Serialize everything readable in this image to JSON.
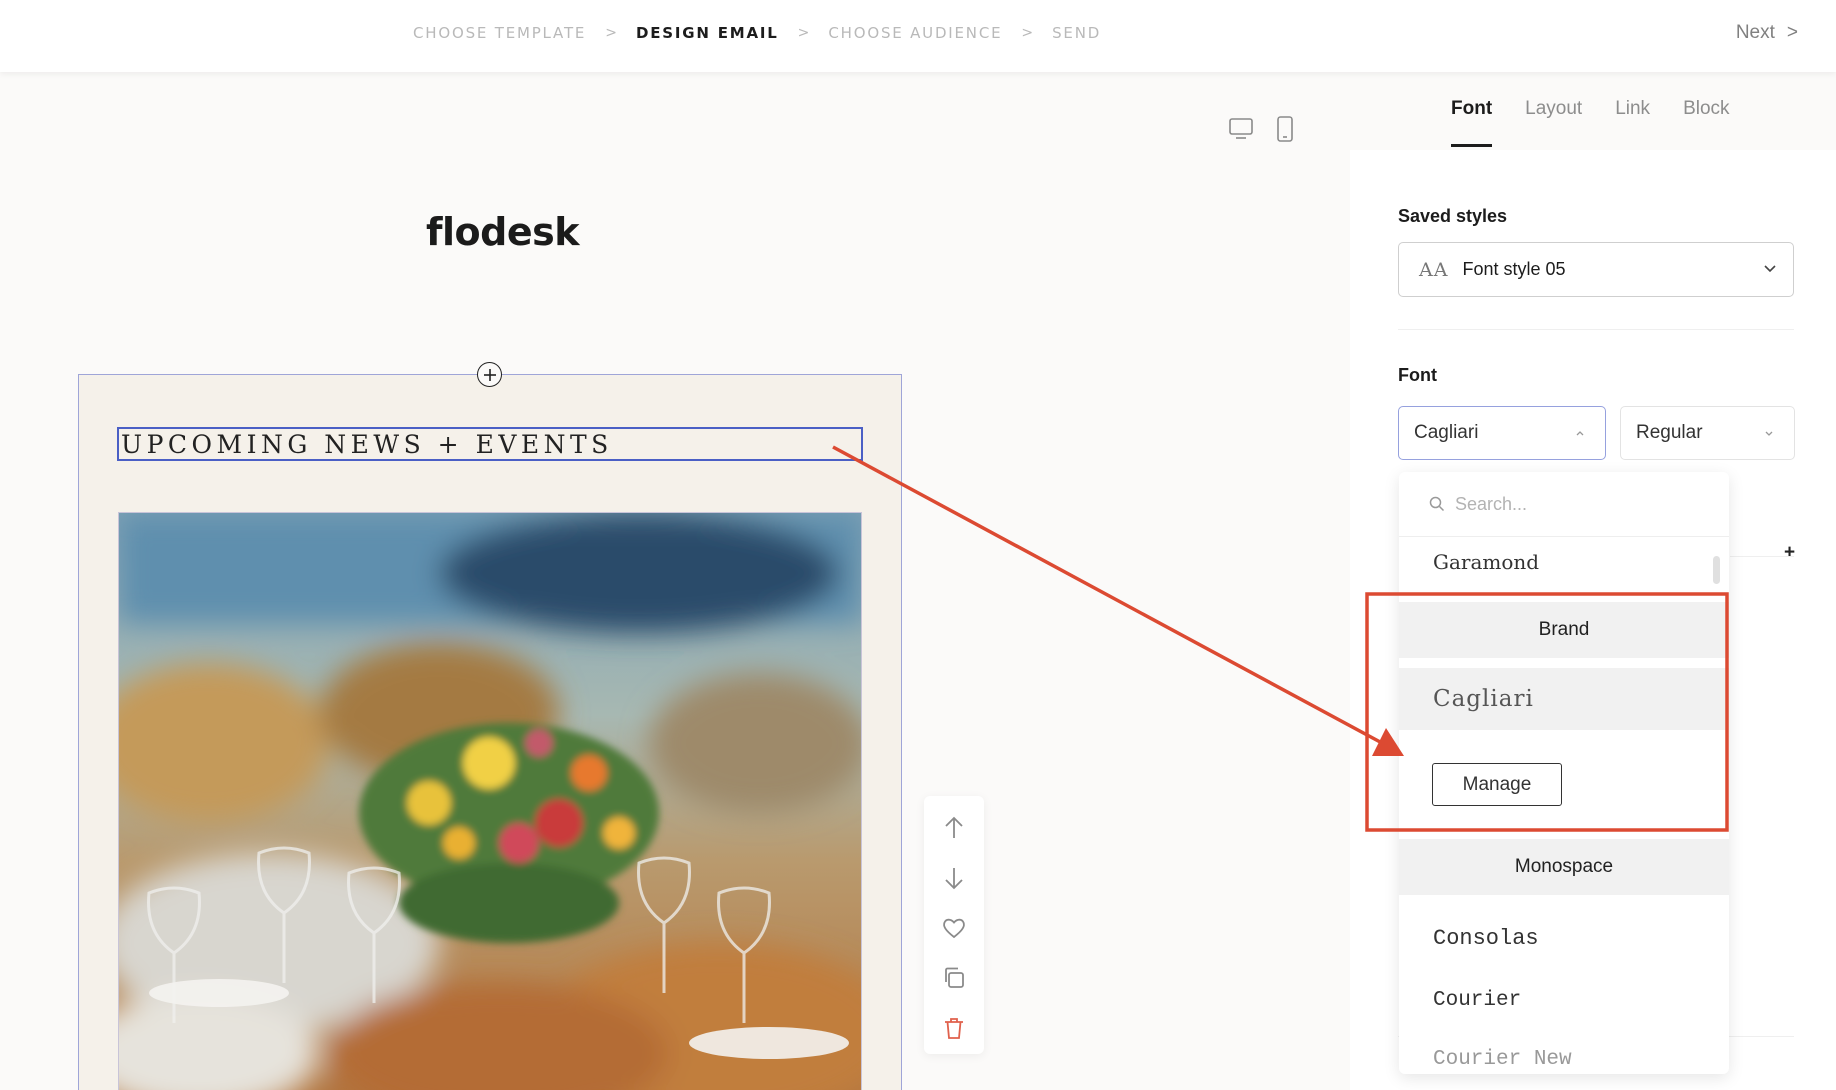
{
  "steps": [
    {
      "label": "CHOOSE TEMPLATE",
      "active": false
    },
    {
      "label": "DESIGN EMAIL",
      "active": true
    },
    {
      "label": "CHOOSE AUDIENCE",
      "active": false
    },
    {
      "label": "SEND",
      "active": false
    }
  ],
  "step_separator": ">",
  "next": {
    "label": "Next",
    "chevron": ">"
  },
  "canvas": {
    "logo": "flodesk",
    "heading": "UPCOMING NEWS + EVENTS"
  },
  "panel": {
    "tabs": [
      "Font",
      "Layout",
      "Link",
      "Block"
    ],
    "active_tab": "Font",
    "saved_styles_label": "Saved styles",
    "saved_style_icon": "AA",
    "saved_style_value": "Font style 05",
    "font_label": "Font",
    "font_value": "Cagliari",
    "weight_value": "Regular",
    "plus": "+"
  },
  "dropdown": {
    "search_placeholder": "Search...",
    "items_top": [
      "Garamond"
    ],
    "brand_group": "Brand",
    "brand_selected": "Cagliari",
    "manage_label": "Manage",
    "mono_group": "Monospace",
    "mono_items": [
      "Consolas",
      "Courier",
      "Courier New"
    ]
  },
  "colors": {
    "accent_blue": "#4a5fc5",
    "annotation_red": "#dc4a32",
    "email_bg": "#f5f1ea",
    "delete_red": "#e0614c"
  },
  "icons": [
    "desktop-icon",
    "mobile-icon",
    "add-circle-icon",
    "arrow-up-icon",
    "arrow-down-icon",
    "heart-icon",
    "duplicate-icon",
    "trash-icon",
    "chevron-down-icon",
    "chevron-up-icon",
    "search-icon"
  ]
}
